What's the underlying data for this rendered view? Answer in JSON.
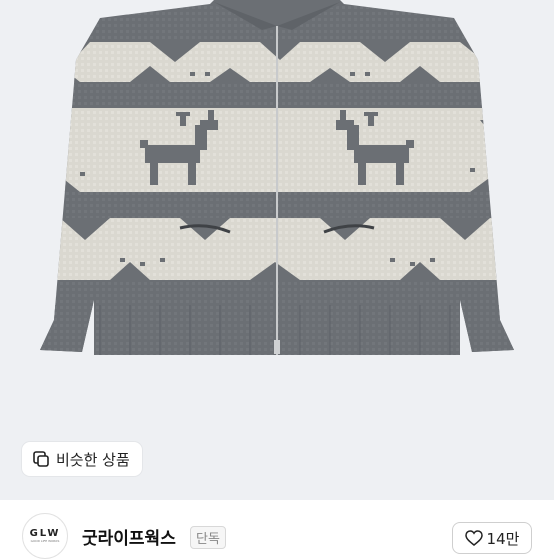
{
  "product": {
    "similar_button_label": "비슷한 상품"
  },
  "shop": {
    "logo_text": "GLW",
    "logo_subtext": "GOOD LIFE WORKS",
    "name": "굿라이프웍스",
    "badge": "단독",
    "like_count": "14만"
  },
  "colors": {
    "image_bg": "#eef0f3",
    "knit_grey": "#6b6f74",
    "knit_cream": "#dcdad3"
  }
}
